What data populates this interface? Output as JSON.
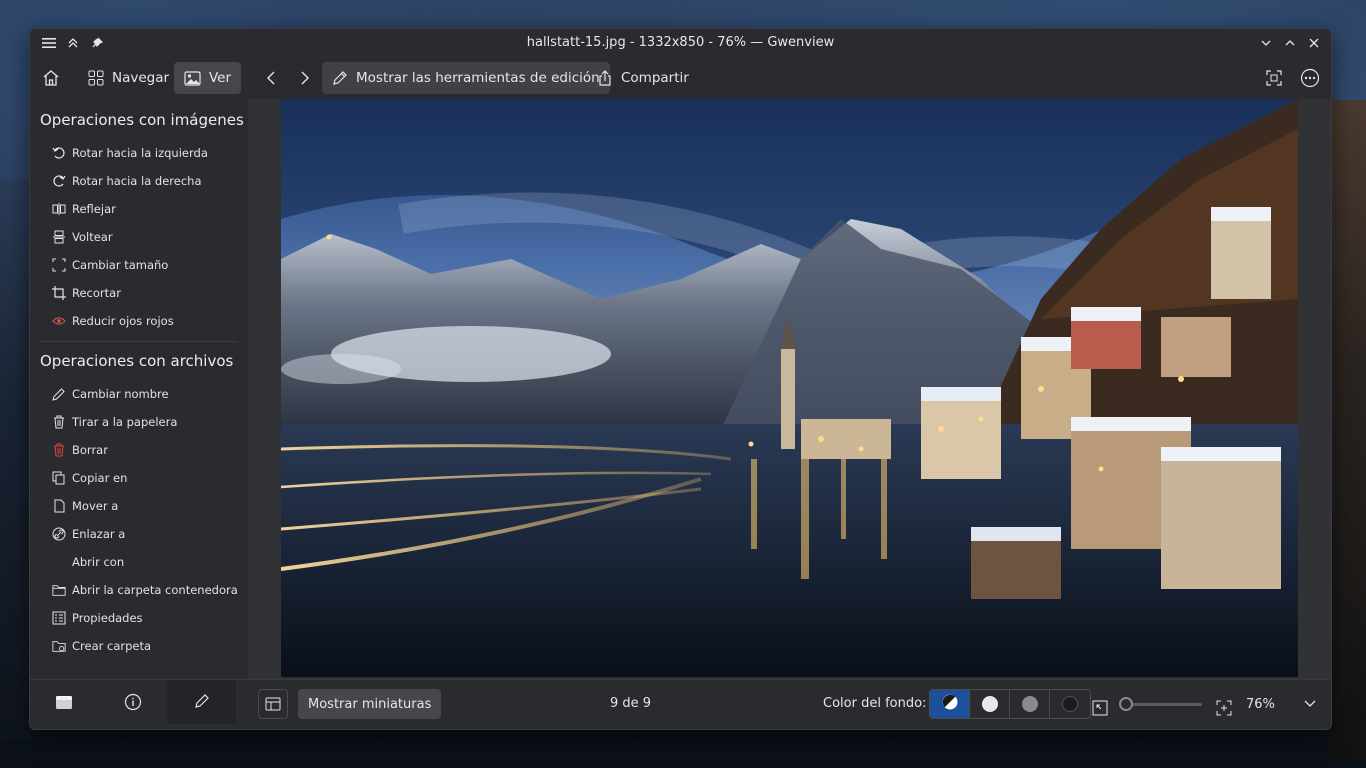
{
  "window": {
    "title": "hallstatt-15.jpg - 1332x850 - 76% — Gwenview"
  },
  "toolbar": {
    "browse_label": "Navegar",
    "view_label": "Ver",
    "edit_tools_label": "Mostrar las herramientas de edición",
    "share_label": "Compartir"
  },
  "sidebar": {
    "image_ops_title": "Operaciones con imágenes",
    "image_ops": [
      {
        "label": "Rotar hacia la izquierda",
        "icon": "rotate-left-icon"
      },
      {
        "label": "Rotar hacia la derecha",
        "icon": "rotate-right-icon"
      },
      {
        "label": "Reflejar",
        "icon": "mirror-icon"
      },
      {
        "label": "Voltear",
        "icon": "flip-icon"
      },
      {
        "label": "Cambiar tamaño",
        "icon": "resize-icon"
      },
      {
        "label": "Recortar",
        "icon": "crop-icon"
      },
      {
        "label": "Reducir ojos rojos",
        "icon": "red-eye-icon"
      }
    ],
    "file_ops_title": "Operaciones con archivos",
    "file_ops": [
      {
        "label": "Cambiar nombre",
        "icon": "rename-icon"
      },
      {
        "label": "Tirar a la papelera",
        "icon": "trash-icon"
      },
      {
        "label": "Borrar",
        "icon": "delete-icon"
      },
      {
        "label": "Copiar en",
        "icon": "copy-icon"
      },
      {
        "label": "Mover a",
        "icon": "move-icon"
      },
      {
        "label": "Enlazar a",
        "icon": "link-icon"
      },
      {
        "label": "Abrir con",
        "icon": ""
      },
      {
        "label": "Abrir la carpeta contenedora",
        "icon": "folder-icon"
      },
      {
        "label": "Propiedades",
        "icon": "properties-icon"
      },
      {
        "label": "Crear carpeta",
        "icon": "folder-new-icon"
      }
    ]
  },
  "bottombar": {
    "thumbnails_label": "Mostrar miniaturas",
    "position": "9 de 9",
    "bg_color_label": "Color del fondo:",
    "zoom": "76%"
  },
  "colors": {
    "accent": "#1d4f9a",
    "delete_red": "#e0473a",
    "red_eye": "#d9534f"
  }
}
